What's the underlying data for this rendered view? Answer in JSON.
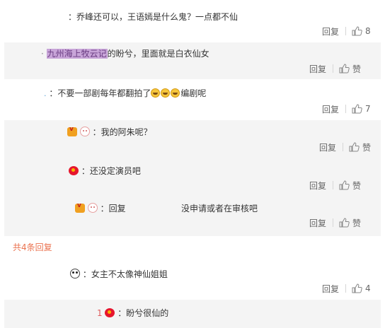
{
  "comments": [
    {
      "text": "：乔峰还可以，王语嫣是什么鬼？一点都不仙",
      "reply": "回复",
      "likes": "8"
    },
    {
      "prefix": "·",
      "highlight": "九州海上牧云记",
      "text": "的盼兮，里面就是白衣仙女",
      "reply": "回复",
      "likes": "赞"
    },
    {
      "prefix": ".",
      "text_before": "：不要一部剧每年都翻拍了",
      "text_after": "编剧呢",
      "reply": "回复",
      "likes": "7"
    }
  ],
  "replies": [
    {
      "text": "：我的阿朱呢？",
      "reply": "回复",
      "likes": "赞"
    },
    {
      "text": "：还没定演员吧",
      "reply": "回复",
      "likes": "赞"
    },
    {
      "text_before": "：回复",
      "text_after": "没申请或者在审核吧",
      "reply": "回复",
      "likes": "赞"
    }
  ],
  "more_replies": "共4条回复",
  "comment4": {
    "text": "：女主不太像神仙姐姐",
    "reply": "回复",
    "likes": "4"
  },
  "reply4": {
    "prefix": "1",
    "text": "：盼兮很仙的"
  },
  "icons": {
    "like": "thumbs-up-icon",
    "laugh": "laugh-cry-emoji",
    "vip": "vip-badge-icon",
    "bunny": "bunny-avatar-icon",
    "weibo": "weibo-logo-icon",
    "panda": "panda-avatar-icon"
  },
  "colors": {
    "accent": "#eb7350",
    "band": "#f4f4f4",
    "highlight": "#c8a5d8"
  }
}
